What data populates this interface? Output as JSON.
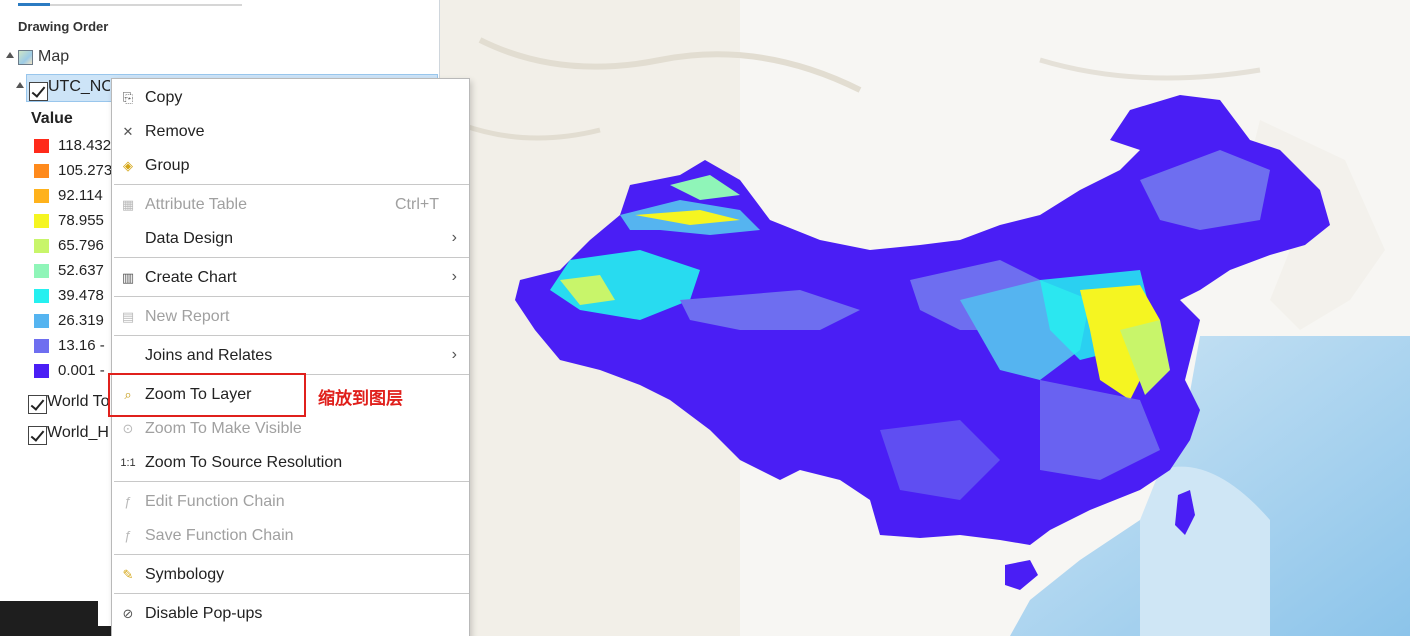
{
  "contents": {
    "section_title": "Drawing Order",
    "map_label": "Map",
    "layer_name": "UTC_NO",
    "value_heading": "Value",
    "legend": [
      {
        "label": "118.432",
        "color": "#ff2a1a"
      },
      {
        "label": "105.273",
        "color": "#ff8a1c"
      },
      {
        "label": "92.114",
        "color": "#ffb21c"
      },
      {
        "label": "78.955",
        "color": "#f5f521"
      },
      {
        "label": "65.796",
        "color": "#c8f56a"
      },
      {
        "label": "52.637",
        "color": "#8ff5b8"
      },
      {
        "label": "39.478",
        "color": "#25f0f0"
      },
      {
        "label": "26.319",
        "color": "#55b4f0"
      },
      {
        "label": "13.16 -",
        "color": "#6e6ef0"
      },
      {
        "label": "0.001 -",
        "color": "#4a1ef5"
      }
    ],
    "basemaps": [
      {
        "label": "World To"
      },
      {
        "label": "World_H"
      }
    ]
  },
  "context_menu": {
    "items": [
      {
        "label": "Copy",
        "icon": "copy-icon",
        "glyph": "⎘",
        "enabled": true
      },
      {
        "label": "Remove",
        "icon": "remove-icon",
        "glyph": "✕",
        "enabled": true
      },
      {
        "label": "Group",
        "icon": "group-icon",
        "glyph": "◈",
        "enabled": true
      },
      {
        "label": "Attribute Table",
        "icon": "table-icon",
        "glyph": "▦",
        "enabled": false,
        "shortcut": "Ctrl+T"
      },
      {
        "label": "Data Design",
        "icon": "",
        "glyph": "",
        "enabled": true,
        "submenu": true
      },
      {
        "label": "Create Chart",
        "icon": "chart-icon",
        "glyph": "▥",
        "enabled": true,
        "submenu": true
      },
      {
        "label": "New Report",
        "icon": "report-icon",
        "glyph": "▤",
        "enabled": false
      },
      {
        "label": "Joins and Relates",
        "icon": "",
        "glyph": "",
        "enabled": true,
        "submenu": true
      },
      {
        "label": "Zoom To Layer",
        "icon": "zoom-to-layer-icon",
        "glyph": "⌕",
        "enabled": true
      },
      {
        "label": "Zoom To Make Visible",
        "icon": "zoom-visible-icon",
        "glyph": "⊙",
        "enabled": false
      },
      {
        "label": "Zoom To Source Resolution",
        "icon": "source-resolution-icon",
        "glyph": "1:1",
        "enabled": true
      },
      {
        "label": "Edit Function Chain",
        "icon": "edit-function-icon",
        "glyph": "ƒ",
        "enabled": false
      },
      {
        "label": "Save Function Chain",
        "icon": "save-function-icon",
        "glyph": "ƒ",
        "enabled": false
      },
      {
        "label": "Symbology",
        "icon": "symbology-icon",
        "glyph": "✎",
        "enabled": true
      },
      {
        "label": "Disable Pop-ups",
        "icon": "popup-icon",
        "glyph": "⊘",
        "enabled": true
      }
    ],
    "arrow_glyph": "›"
  },
  "annotation": {
    "text": "缩放到图层",
    "color": "#e0201c"
  },
  "colors": {
    "selection": "#cde4f7",
    "accent": "#2b7bc2"
  }
}
